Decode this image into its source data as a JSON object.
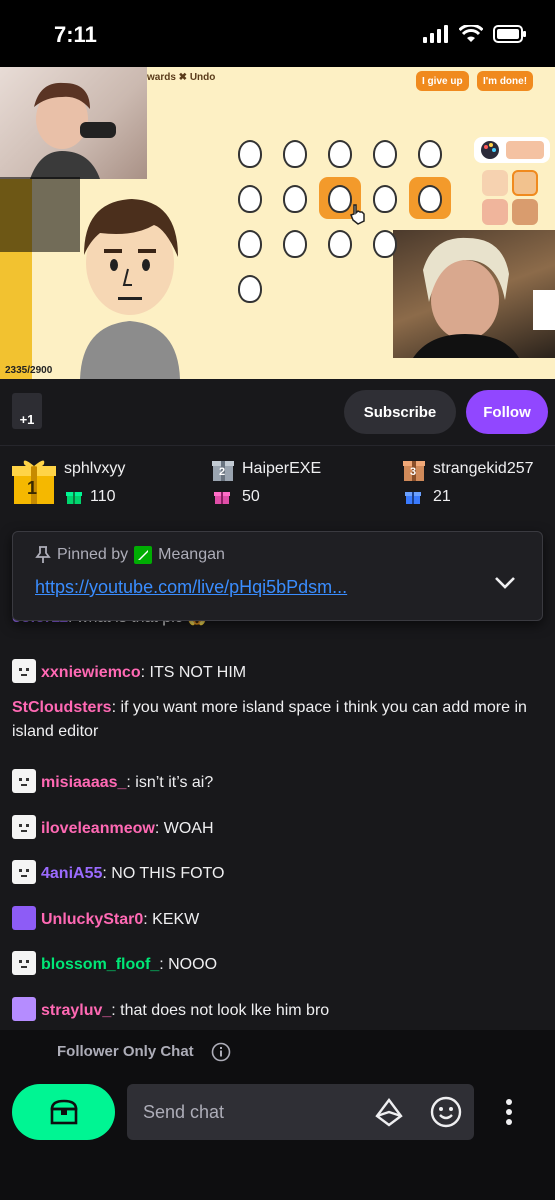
{
  "status_bar": {
    "time": "7:11"
  },
  "video": {
    "game_toolbar_text": "wards ✖ Undo",
    "give_up_label": "I give up",
    "done_label": "I'm done!",
    "counter": "2335/2900"
  },
  "channel_actions": {
    "boost_label": "+1",
    "subscribe_label": "Subscribe",
    "follow_label": "Follow"
  },
  "leaderboard": [
    {
      "rank": "1",
      "name": "sphlvxyy",
      "count": "110"
    },
    {
      "rank": "2",
      "name": "HaiperEXE",
      "count": "50"
    },
    {
      "rank": "3",
      "name": "strangekid257",
      "count": "21"
    }
  ],
  "pinned": {
    "by_prefix": "Pinned by",
    "by_user": "Meangan",
    "link": "https://youtube.com/live/pHqi5bPdsm..."
  },
  "chat": [
    {
      "user": "color11",
      "text": "what is that pic 😱",
      "color": "#9b6bff"
    },
    {
      "user": "xxniewiemco",
      "text": "ITS NOT HIM",
      "color": "#ff69b4"
    },
    {
      "user": "StCloudsters",
      "text": "if you want more island space i think you can add more in island editor",
      "color": "#ff69b4"
    },
    {
      "user": "misiaaaas_",
      "text": "isn’t it’s ai?",
      "color": "#ff69b4"
    },
    {
      "user": "iloveleanmeow",
      "text": "WOAH",
      "color": "#ff69b4"
    },
    {
      "user": "4aniA55",
      "text": "NO THIS FOTO",
      "color": "#9b6bff"
    },
    {
      "user": "UnluckyStar0",
      "text": "KEKW",
      "color": "#ff69b4"
    },
    {
      "user": "blossom_floof_",
      "text": "NOOO",
      "color": "#00e676"
    },
    {
      "user": "strayluv_",
      "text": "that does not look lke him bro",
      "color": "#ff69b4"
    }
  ],
  "footer": {
    "follower_only": "Follower Only Chat",
    "chat_placeholder": "Send chat"
  },
  "colors": {
    "follow": "#9147ff",
    "drops": "#00f593",
    "link": "#3a8dff"
  }
}
